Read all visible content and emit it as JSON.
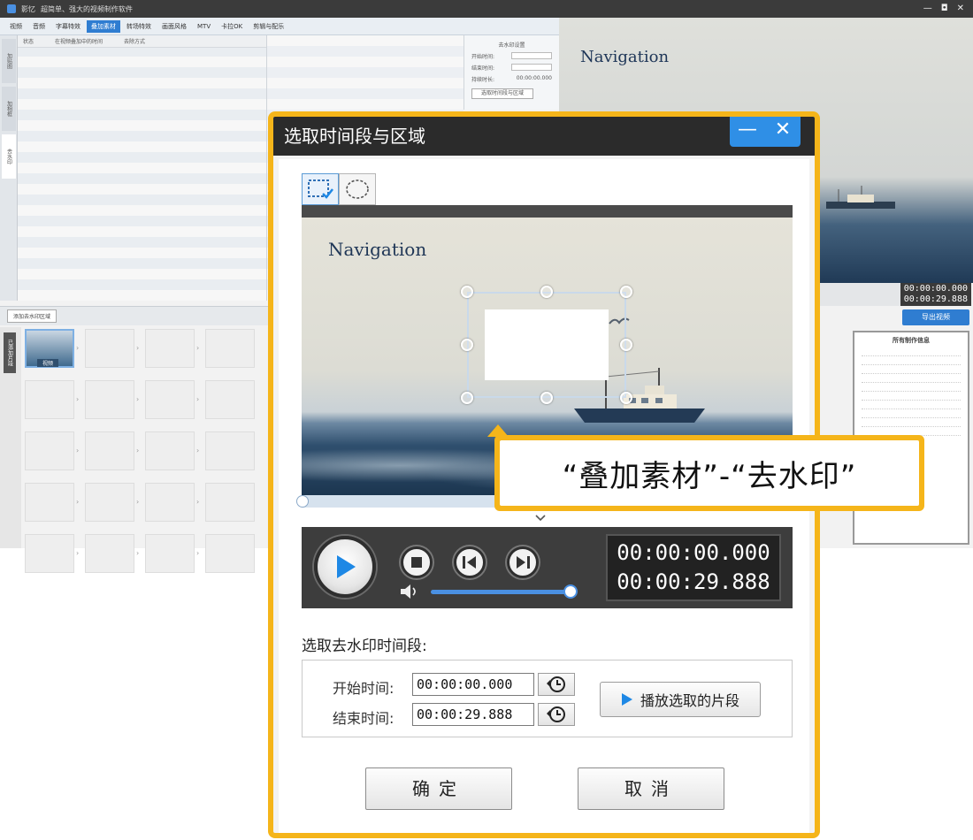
{
  "background_app": {
    "title": "影忆",
    "subtitle": "超简单、强大的视频制作软件",
    "menu_tabs": [
      "视频",
      "音频",
      "字幕特效",
      "叠加素材",
      "转场特效",
      "画面风格",
      "MTV",
      "卡拉OK",
      "剪辑与配乐"
    ],
    "active_tab_index": 3,
    "left_rail": [
      "加贴图",
      "加相框",
      "去水印"
    ],
    "list_headers": [
      "状态",
      "在视频叠加中的时间",
      "去除方式"
    ],
    "props": {
      "title": "去水印设置",
      "start_label": "开始时间:",
      "end_label": "结束时间:",
      "duration_label": "持续时长:",
      "start_value": "00:00:00.000",
      "end_value": "00:00:00.000",
      "duration_value": "00:00:00.000",
      "button": "选取时间段与区域"
    },
    "preview_title": "Navigation",
    "preview_time": [
      "00:00:00.000",
      "00:00:29.888"
    ],
    "export_button": "导出视频",
    "info_title": "所有制作信息",
    "overlay_button": "添加去水印区域",
    "timeline_tab": "已添加片段",
    "clip_label": "视频",
    "clip_sub": "双击"
  },
  "dialog": {
    "title": "选取时间段与区域",
    "min_icon": "minimize-icon",
    "close_icon": "close-icon",
    "tools": [
      "rect-select-icon",
      "ellipse-select-icon"
    ],
    "preview_title": "Navigation",
    "progress": 0.0,
    "timecode_current": "00:00:00.000",
    "timecode_total": "00:00:29.888",
    "volume": 1.0,
    "callout": "“叠加素材”-“去水印”",
    "section_title": "选取去水印时间段:",
    "start_label": "开始时间:",
    "end_label": "结束时间:",
    "start_value": "00:00:00.000",
    "end_value": "00:00:29.888",
    "play_segment_label": "播放选取的片段",
    "ok_label": "确定",
    "cancel_label": "取消"
  },
  "colors": {
    "accent_yellow": "#f5b51a",
    "title_bar": "#2b2b2b",
    "brand_blue": "#2f8fe6",
    "play_blue": "#1e88e5"
  }
}
